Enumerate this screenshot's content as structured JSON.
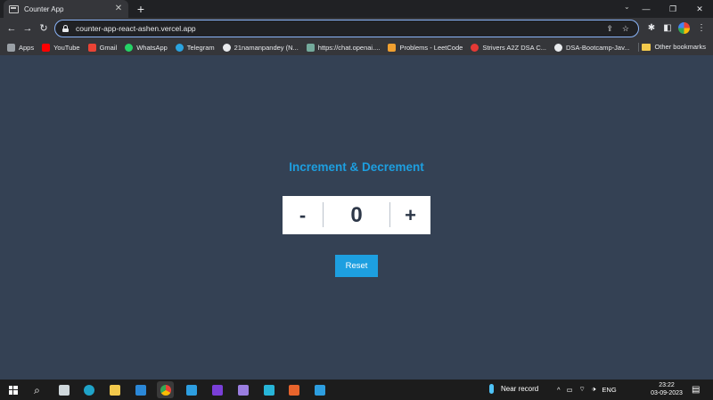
{
  "browser": {
    "tab": {
      "title": "Counter App",
      "close_glyph": "✕"
    },
    "new_tab_glyph": "+",
    "tab_search_glyph": "⌄",
    "window_controls": {
      "minimize": "—",
      "restore": "❐",
      "close": "✕"
    },
    "nav": {
      "back": "←",
      "forward": "→",
      "reload": "↻"
    },
    "address_bar": {
      "url": "counter-app-react-ashen.vercel.app",
      "share_glyph": "⇪",
      "star_glyph": "☆"
    },
    "toolbar_icons": {
      "extensions": "✱",
      "side_panel": "◧",
      "menu": "⋮"
    },
    "bookmarks": [
      {
        "label": "Apps",
        "color": "#9aa0a6"
      },
      {
        "label": "YouTube",
        "color": "#ff0000"
      },
      {
        "label": "Gmail",
        "color": "#ea4335"
      },
      {
        "label": "WhatsApp",
        "color": "#25d366"
      },
      {
        "label": "Telegram",
        "color": "#2aa3df"
      },
      {
        "label": "21namanpandey (N...",
        "color": "#e8eaed"
      },
      {
        "label": "https://chat.openai....",
        "color": "#74aa9c"
      },
      {
        "label": "Problems - LeetCode",
        "color": "#f0a030"
      },
      {
        "label": "Strivers A2Z DSA C...",
        "color": "#e53935"
      },
      {
        "label": "DSA-Bootcamp-Jav...",
        "color": "#e8eaed"
      }
    ],
    "other_bookmarks": "Other bookmarks"
  },
  "app": {
    "heading": "Increment & Decrement",
    "decrement_label": "-",
    "count": "0",
    "increment_label": "+",
    "reset_label": "Reset",
    "accent_color": "#1d9fe0",
    "background_color": "#344154"
  },
  "taskbar": {
    "search_glyph": "⌕",
    "weather_text": "Near record",
    "tray": {
      "chevron": "^",
      "lang": "ENG",
      "wifi": "⌔",
      "volume": "🕩",
      "battery": "▭"
    },
    "time": "23:22",
    "date": "03-09-2023",
    "notification_glyph": "▤"
  }
}
